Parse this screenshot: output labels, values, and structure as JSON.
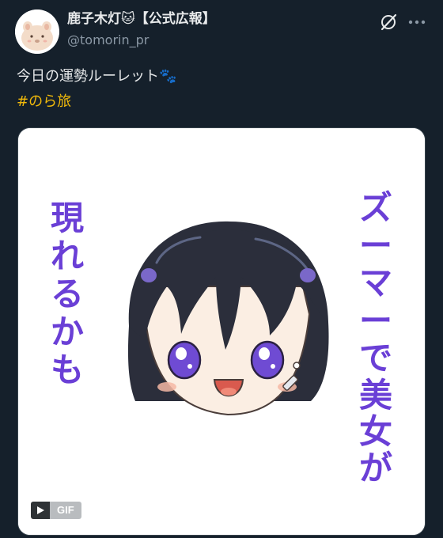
{
  "author": {
    "display_name": "鹿子木灯🐱【公式広報】",
    "handle": "@tomorin_pr"
  },
  "post": {
    "text": "今日の運勢ルーレット🐾",
    "hashtag": "#のら旅"
  },
  "media": {
    "type": "GIF",
    "left_caption": "現れるかも",
    "right_caption": "ズーマーで美女が",
    "gif_label": "GIF"
  },
  "icons": {
    "grok": "grok-icon",
    "more": "more-icon",
    "play": "play-icon"
  },
  "colors": {
    "background": "#15202b",
    "text": "#e7e9ea",
    "muted": "#8b98a5",
    "hashtag": "#f0b90b",
    "caption": "#6a3fd6"
  }
}
